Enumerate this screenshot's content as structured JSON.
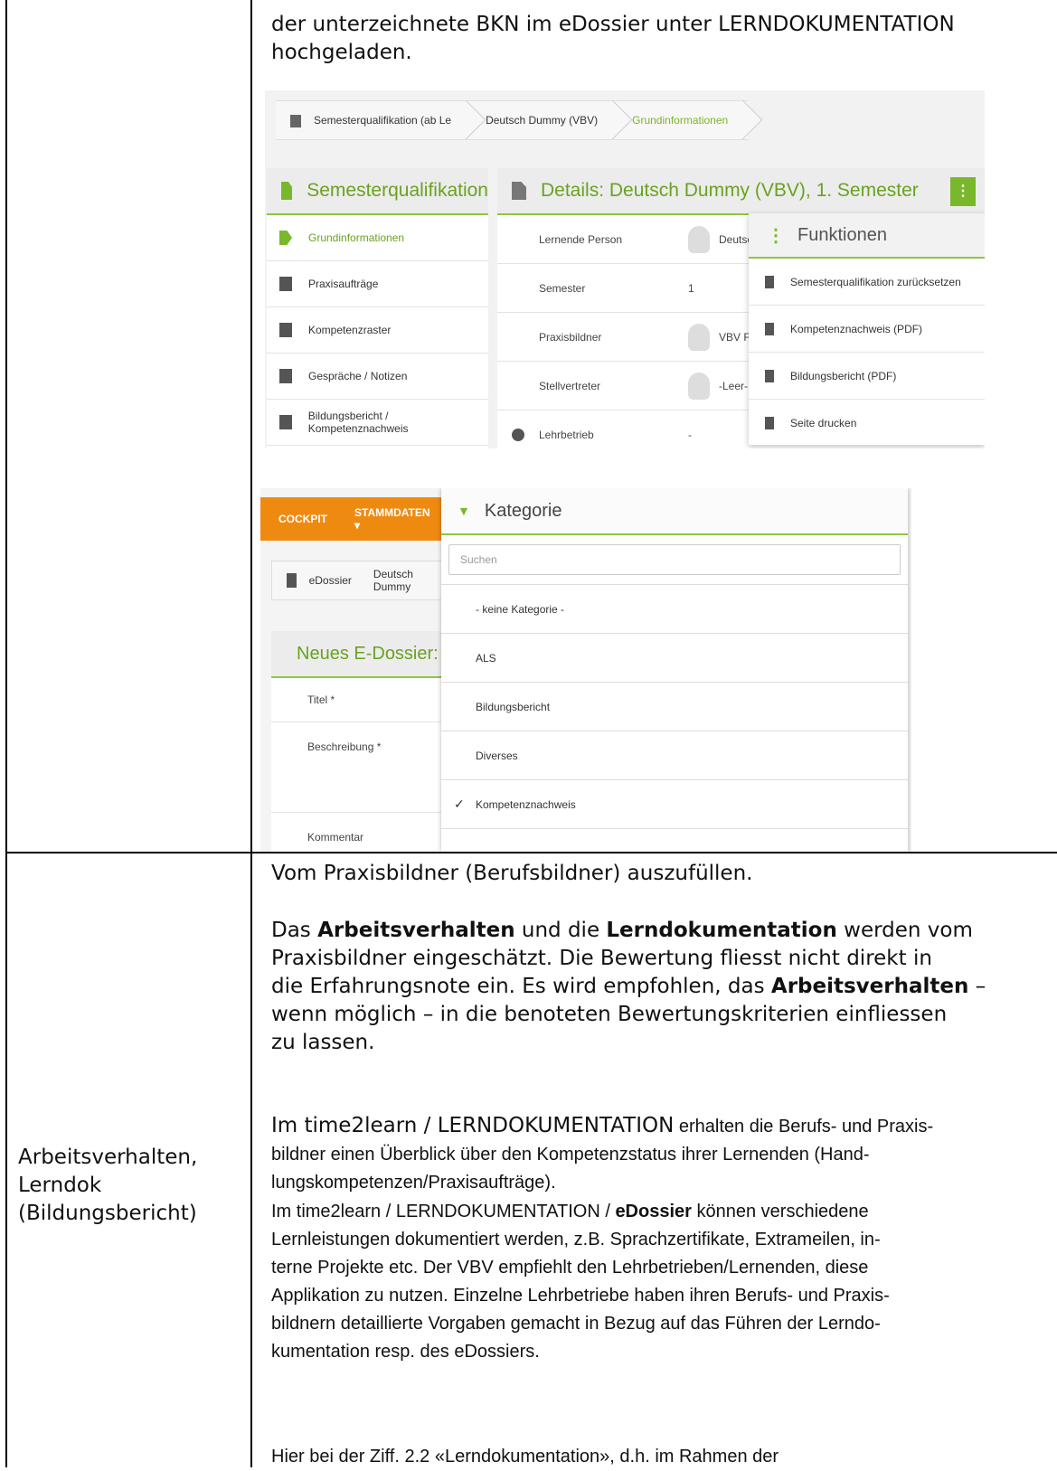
{
  "top_text": {
    "line1": "der unterzeichnete BKN im eDossier unter LERNDOKUMENTATION",
    "line2": "hochgeladen."
  },
  "screenshot1": {
    "breadcrumbs": [
      "Semesterqualifikation (ab Le",
      "Deutsch Dummy (VBV)",
      "Grundinformationen"
    ],
    "left_panel": {
      "title": "Semesterqualifikation",
      "items": [
        "Grundinformationen",
        "Praxisaufträge",
        "Kompetenzraster",
        "Gespräche / Notizen",
        "Bildungsbericht / Kompetenznachweis"
      ]
    },
    "details_panel": {
      "title": "Details: Deutsch Dummy (VBV), 1. Semester",
      "menu_button": "⋮",
      "rows": [
        {
          "label": "Lernende Person",
          "value": "Deutsc"
        },
        {
          "label": "Semester",
          "value": "1"
        },
        {
          "label": "Praxisbildner",
          "value": "VBV Fir"
        },
        {
          "label": "Stellvertreter",
          "value": "-Leer-"
        },
        {
          "label": "Lehrbetrieb",
          "value": "-"
        }
      ]
    },
    "functions_menu": {
      "title": "Funktionen",
      "items": [
        "Semesterqualifikation zurücksetzen",
        "Kompetenznachweis (PDF)",
        "Bildungsbericht (PDF)",
        "Seite drucken"
      ]
    }
  },
  "screenshot2": {
    "nav": {
      "cockpit": "COCKPIT",
      "stammdaten": "STAMMDATEN ▾"
    },
    "breadcrumbs": [
      "eDossier",
      "Deutsch Dummy"
    ],
    "form_title": "Neues E-Dossier: Deu",
    "form_fields": [
      "Titel *",
      "Beschreibung *",
      "Kommentar"
    ],
    "dropdown": {
      "title": "Kategorie",
      "search_placeholder": "Suchen",
      "options": [
        "- keine Kategorie -",
        "ALS",
        "Bildungsbericht",
        "Diverses",
        "Kompetenznachweis"
      ],
      "selected": "Kompetenznachweis"
    }
  },
  "left_label": {
    "line1": "Arbeitsverhalten,",
    "line2": "Lerndok",
    "line3": "(Bildungsbericht)"
  },
  "body": {
    "p1": "Vom Praxisbildner (Berufsbildner) auszufüllen.",
    "p2": {
      "t1": "Das ",
      "b1": "Arbeitsverhalten",
      "t2": " und die ",
      "b2": "Lerndokumentation",
      "t3": " werden vom",
      "l2": "Praxisbildner eingeschätzt. Die Bewertung fliesst nicht direkt in",
      "l3a": "die Erfahrungsnote ein. Es wird empfohlen, das ",
      "b3": "Arbeitsverhalten",
      "l3b": " –",
      "l4": "wenn möglich – in die benoteten Bewertungskriterien einfliessen",
      "l5": "zu lassen."
    },
    "p3": {
      "lead": "Im time2learn / LERNDOKUMENTATION",
      "rest1": " erhalten die Berufs- und Praxis-",
      "l2": "bildner einen Überblick über den Kompetenzstatus ihrer Lernenden (Hand-",
      "l3": "lungskompetenzen/Praxisaufträge)."
    },
    "p4": {
      "a": "Im time2learn / LERNDOKUMENTATION / ",
      "b": "eDossier",
      "c": " können verschiedene",
      "l2": "Lernleistungen dokumentiert werden, z.B. Sprachzertifikate, Extrameilen, in-",
      "l3": "terne Projekte etc. Der VBV empfiehlt den Lehrbetrieben/Lernenden, diese",
      "l4": "Applikation zu nutzen. Einzelne Lehrbetriebe haben ihren Berufs- und Praxis-",
      "l5": "bildnern detaillierte Vorgaben gemacht in Bezug auf das Führen der Lerndo-",
      "l6": "kumentation resp. des eDossiers."
    },
    "p5": "Hier bei der Ziff. 2.2 «Lerndokumentation», d.h. im Rahmen der"
  }
}
